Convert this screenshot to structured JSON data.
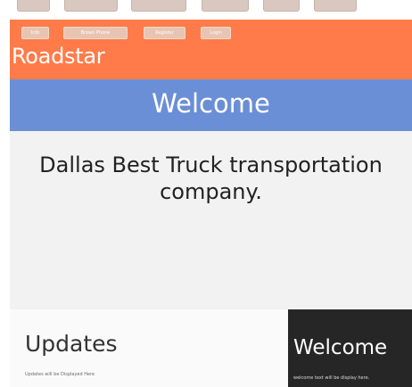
{
  "top_tabs": [
    "",
    "",
    "",
    "",
    "",
    ""
  ],
  "nav": {
    "items": [
      "Info",
      "Brown Phone",
      "Register",
      "Login"
    ]
  },
  "header": {
    "brand": "Roadstar"
  },
  "banner": {
    "title": "Welcome"
  },
  "hero": {
    "text": "Dallas Best Truck transportation company."
  },
  "updates": {
    "title": "Updates",
    "subtitle": "Updates will be Displayed Here"
  },
  "welcome_box": {
    "title": "Welcome",
    "subtitle": "welcome text will be display here."
  },
  "colors": {
    "header_bg": "#ff7b4a",
    "banner_bg": "#6b8fd6",
    "welcome_box_bg": "#262626"
  }
}
